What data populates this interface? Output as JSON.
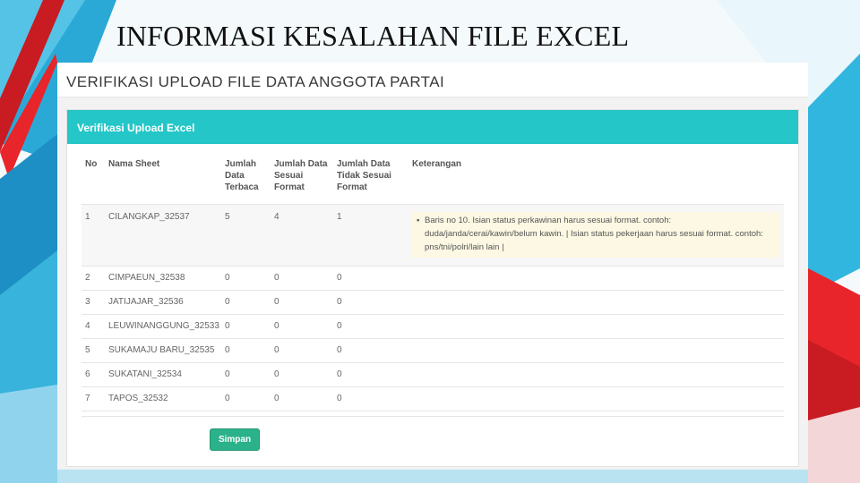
{
  "slide": {
    "title": "INFORMASI KESALAHAN FILE EXCEL"
  },
  "colors": {
    "accent_teal": "#24c6c8",
    "red": "#e8252a",
    "save_green": "#2bb28a",
    "note_bg": "#fcf8e3"
  },
  "page": {
    "heading": "VERIFIKASI UPLOAD FILE DATA ANGGOTA PARTAI"
  },
  "panel": {
    "title": "Verifikasi Upload Excel"
  },
  "table": {
    "headers": {
      "no": "No",
      "sheet": "Nama Sheet",
      "total": "Jumlah Data Terbaca",
      "valid": "Jumlah Data Sesuai Format",
      "invalid": "Jumlah Data Tidak Sesuai Format",
      "note": "Keterangan"
    },
    "rows": [
      {
        "no": "1",
        "sheet": "CILANGKAP_32537",
        "total": "5",
        "valid": "4",
        "invalid": "1",
        "note": "Baris no 10. Isian status perkawinan harus sesuai format. contoh: duda/janda/cerai/kawin/belum kawin. | Isian status pekerjaan harus sesuai format. contoh: pns/tni/polri/lain lain |"
      },
      {
        "no": "2",
        "sheet": "CIMPAEUN_32538",
        "total": "0",
        "valid": "0",
        "invalid": "0"
      },
      {
        "no": "3",
        "sheet": "JATIJAJAR_32536",
        "total": "0",
        "valid": "0",
        "invalid": "0"
      },
      {
        "no": "4",
        "sheet": "LEUWINANGGUNG_32533",
        "total": "0",
        "valid": "0",
        "invalid": "0"
      },
      {
        "no": "5",
        "sheet": "SUKAMAJU BARU_32535",
        "total": "0",
        "valid": "0",
        "invalid": "0"
      },
      {
        "no": "6",
        "sheet": "SUKATANI_32534",
        "total": "0",
        "valid": "0",
        "invalid": "0"
      },
      {
        "no": "7",
        "sheet": "TAPOS_32532",
        "total": "0",
        "valid": "0",
        "invalid": "0"
      }
    ]
  },
  "actions": {
    "save_label": "Simpan"
  }
}
